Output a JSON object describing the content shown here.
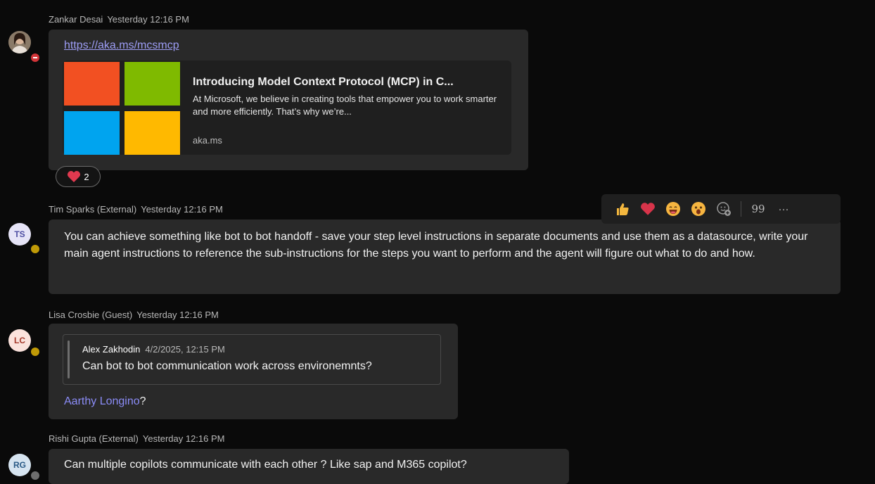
{
  "messages": [
    {
      "author": "Zankar Desai",
      "time": "Yesterday 12:16 PM",
      "link": "https://aka.ms/mcsmcp",
      "preview": {
        "title": "Introducing Model Context Protocol (MCP) in C...",
        "description": "At Microsoft, we believe in creating tools that empower you to work smarter and more efficiently. That’s why we’re...",
        "domain": "aka.ms",
        "colors": [
          "#F25022",
          "#7FBA00",
          "#00A4EF",
          "#FFB900"
        ]
      },
      "reaction": {
        "icon": "heart-icon",
        "count": "2"
      }
    },
    {
      "author": "Tim Sparks (External)",
      "time": "Yesterday 12:16 PM",
      "initials": "TS",
      "text": "You can achieve something like bot to bot handoff - save your step level instructions in separate documents and use them as a datasource, write your main agent instructions to reference the sub-instructions for the steps you want to perform and the agent will figure out what to do and how."
    },
    {
      "author": "Lisa Crosbie (Guest)",
      "time": "Yesterday 12:16 PM",
      "initials": "LC",
      "quote": {
        "author": "Alex Zakhodin",
        "time": "4/2/2025, 12:15 PM",
        "text": "Can bot to bot communication work across environemnts?"
      },
      "mention": "Aarthy Longino",
      "suffix": "?"
    },
    {
      "author": "Rishi Gupta (External)",
      "time": "Yesterday 12:16 PM",
      "initials": "RG",
      "text": "Can multiple copilots communicate with each other ? Like sap and M365 copilot?"
    }
  ],
  "reaction_bar": {
    "items": [
      "like-icon",
      "heart-icon",
      "laugh-icon",
      "surprised-icon",
      "add-reaction-icon",
      "quote-icon",
      "more-options-icon"
    ],
    "quote_glyph": "99",
    "more_glyph": "···"
  },
  "colors": {
    "mention": "#8b8cf7",
    "link": "#9d9df5",
    "away": "#c09a07",
    "busy": "#d13438"
  }
}
